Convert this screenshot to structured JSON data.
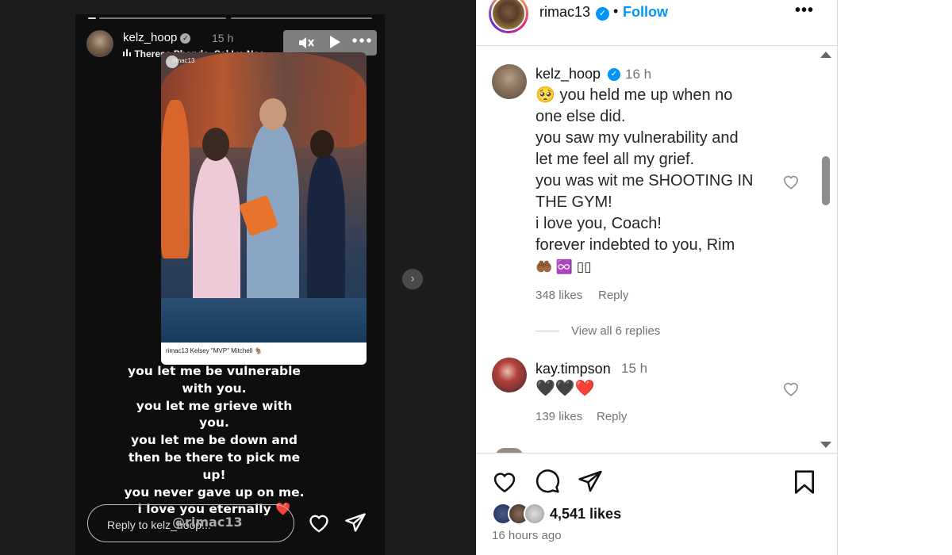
{
  "story": {
    "username": "kelz_hoop",
    "verified_mark": "✓",
    "time": "15 h",
    "music": "Theresa Phondo, Sal Ly, Noe",
    "shared_post": {
      "username": "rimac13",
      "caption": "rimac13 Kelsey \"MVP\" Mitchell 🐐"
    },
    "text_lines": [
      "you let me be vulnerable",
      "with you.",
      "you let me grieve with",
      "you.",
      "you let me be down and",
      "then be there to pick me",
      "up!",
      "you never gave up on me.",
      "i love you eternally"
    ],
    "heart_emoji": "❤️",
    "reply_placeholder": "Reply to kelz_hoop...",
    "mention": "@rimac13",
    "icons": [
      "mute-icon",
      "play-icon",
      "more-icon",
      "like-icon",
      "share-icon",
      "next-icon"
    ]
  },
  "post": {
    "owner": "rimac13",
    "follow_label": "Follow",
    "more_label": "•••",
    "comments": [
      {
        "username": "kelz_hoop",
        "verified": true,
        "time": "16 h",
        "lines": [
          "🥺 you held me up when no",
          "one else did.",
          "you saw my vulnerability and",
          "let me feel all my grief.",
          "you was wit me SHOOTING IN",
          "THE GYM!",
          "i love you, Coach!",
          "forever indebted to you, Rim",
          "🤲🏾 ♾️ ▯▯"
        ],
        "likes": "348 likes",
        "reply": "Reply",
        "view_replies": "View all 6 replies"
      },
      {
        "username": "kay.timpson",
        "verified": false,
        "time": "15 h",
        "lines": [
          "🖤🖤❤️"
        ],
        "likes": "139 likes",
        "reply": "Reply"
      }
    ],
    "likes_count": "4,541 likes",
    "posted_ago": "16 hours ago"
  },
  "colors": {
    "follow_blue": "#0095f6",
    "verified_blue": "#0095f6",
    "dark_bg": "#1c1c1c"
  }
}
